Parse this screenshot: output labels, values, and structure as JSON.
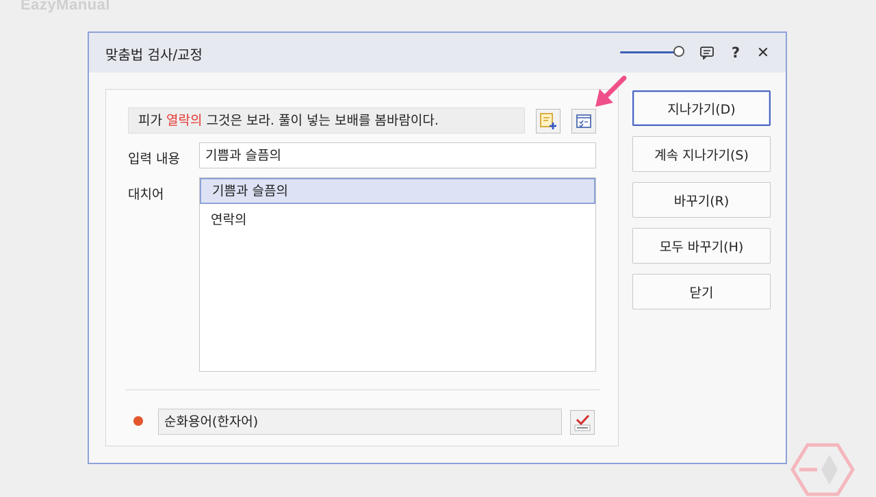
{
  "watermark": "EazyManual",
  "dialog": {
    "title": "맞춤법 검사/교정",
    "sentence": {
      "before": "피가 ",
      "error_word": "열락의",
      "after": " 그것은 보라. 풀이 넣는 보배를 봄바람이다."
    },
    "input_label": "입력 내용",
    "input_value": "기쁨과 슬픔의",
    "suggestions_label": "대치어",
    "suggestions": [
      "기쁨과 슬픔의",
      "연락의"
    ],
    "selected_suggestion_index": 0,
    "dictionary_value": "순화용어(한자어)",
    "buttons": {
      "skip": "지나가기(D)",
      "skip_all": "계속 지나가기(S)",
      "replace": "바꾸기(R)",
      "replace_all": "모두 바꾸기(H)",
      "close": "닫기"
    },
    "titlebar_icons": {
      "help": "?",
      "close": "✕"
    }
  },
  "colors": {
    "accent": "#4a66c2",
    "error_text": "#e53935",
    "status_dot": "#e4572e",
    "annotation_arrow": "#f0508a"
  }
}
